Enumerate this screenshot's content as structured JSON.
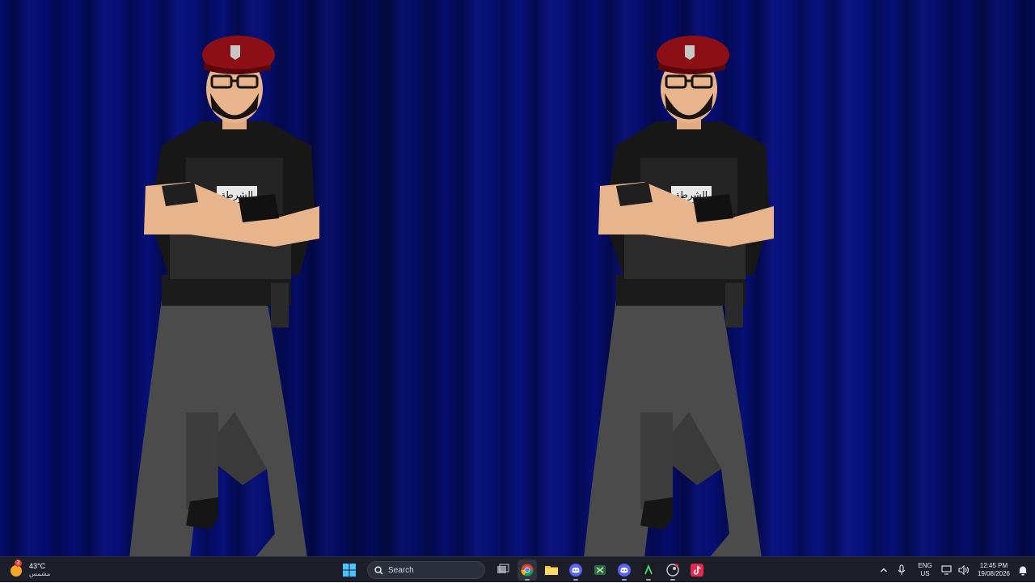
{
  "taskbar": {
    "weather": {
      "temperature": "43°C",
      "condition": "مشمس",
      "badge": "3"
    },
    "search": {
      "label": "Search"
    },
    "apps": [
      {
        "name": "start-button",
        "icon": "windows-logo-icon"
      },
      {
        "name": "task-view",
        "icon": "task-view-icon"
      },
      {
        "name": "chrome",
        "icon": "chrome-icon"
      },
      {
        "name": "file-explorer",
        "icon": "folder-icon"
      },
      {
        "name": "discord",
        "icon": "discord-icon"
      },
      {
        "name": "xbox",
        "icon": "xbox-icon"
      },
      {
        "name": "discord-2",
        "icon": "discord-icon"
      },
      {
        "name": "editor",
        "icon": "lambda-icon"
      },
      {
        "name": "steam",
        "icon": "steam-icon"
      },
      {
        "name": "tiktok",
        "icon": "tiktok-icon"
      }
    ],
    "tray": {
      "language_line1": "ENG",
      "language_line2": "US",
      "time": "12:45 PM",
      "date": "19/08/2026"
    }
  },
  "wallpaper": {
    "vest_label": "الشرطة",
    "colors": {
      "background": "#050c6e",
      "beret": "#8b0f14"
    }
  }
}
